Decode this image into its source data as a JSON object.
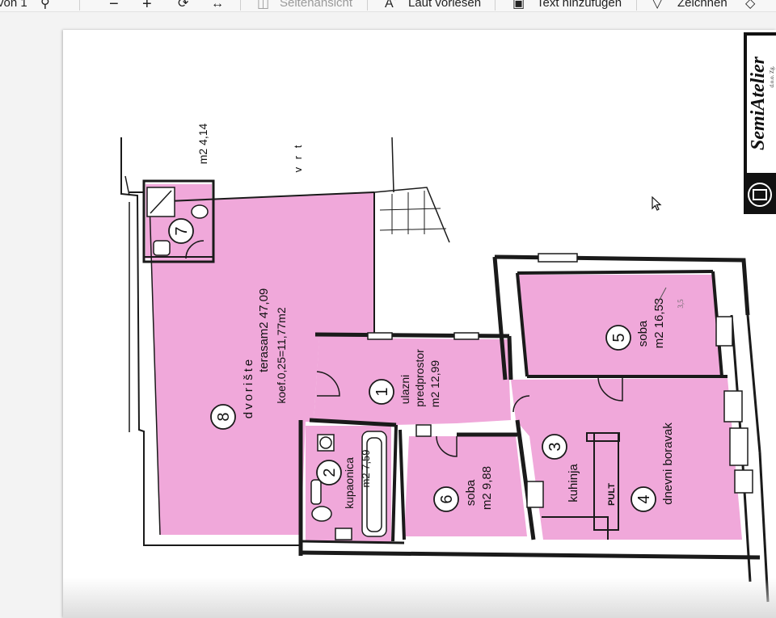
{
  "toolbar": {
    "page_of": "von 1",
    "page_view": "Seitenansicht",
    "read_aloud": "Laut vorlesen",
    "add_text": "Text hinzufügen",
    "draw": "Zeichnen",
    "icons": [
      "search-icon",
      "zoom-out-icon",
      "zoom-in-icon",
      "rotate-icon",
      "fit-width-icon",
      "page-view-icon",
      "read-aloud-icon",
      "add-text-icon",
      "draw-icon"
    ]
  },
  "plan": {
    "logo_text": "SemiAtelier",
    "logo_small": "d.o.o. Zg.",
    "garden": "v r t",
    "area_7": "m2 4,14",
    "rooms": [
      {
        "num": "8",
        "name": "dvorište",
        "line2": "terasa",
        "area": "m2 47,09",
        "coef": "koef.0,25=11,77m2"
      },
      {
        "num": "1",
        "name": "ulazni",
        "line2": "predprostor",
        "area": "m2 12,99"
      },
      {
        "num": "2",
        "name": "kupaonica",
        "area": "m2 7,59"
      },
      {
        "num": "6",
        "name": "soba",
        "area": "m2 9,88"
      },
      {
        "num": "3",
        "name": "kuhinja"
      },
      {
        "num": "4",
        "name": "dnevni boravak"
      },
      {
        "num": "5",
        "name": "soba",
        "area": "m2 16,53"
      },
      {
        "num": "7"
      }
    ],
    "pult": "PULT",
    "handnote": "3,5"
  },
  "colors": {
    "room_fill": "#f0a8da",
    "wall": "#1a1a1a"
  }
}
